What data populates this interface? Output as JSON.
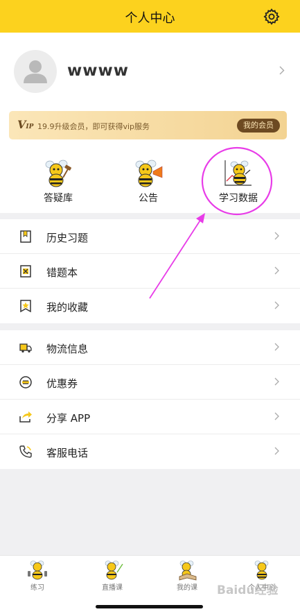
{
  "header": {
    "title": "个人中心",
    "settings_icon": "gear-icon"
  },
  "profile": {
    "username": "wwww",
    "avatar_icon": "user-placeholder-icon"
  },
  "vip_banner": {
    "logo": "V",
    "logo_sub": "IP",
    "text": "19.9升级会员，即可获得vip服务",
    "button": "我的会员"
  },
  "quick_actions": [
    {
      "label": "答疑库",
      "icon": "bee-gavel-icon"
    },
    {
      "label": "公告",
      "icon": "bee-megaphone-icon"
    },
    {
      "label": "学习数据",
      "icon": "bee-chart-icon"
    }
  ],
  "menu_group_1": [
    {
      "label": "历史习题",
      "icon": "bookmark-icon"
    },
    {
      "label": "错题本",
      "icon": "wrong-book-icon"
    },
    {
      "label": "我的收藏",
      "icon": "star-bookmark-icon"
    }
  ],
  "menu_group_2": [
    {
      "label": "物流信息",
      "icon": "truck-icon"
    },
    {
      "label": "优惠券",
      "icon": "coupon-icon"
    },
    {
      "label": "分享 APP",
      "icon": "share-icon"
    },
    {
      "label": "客服电话",
      "icon": "phone-icon"
    }
  ],
  "tabbar": [
    {
      "label": "练习",
      "icon": "bee-dumbbell-icon"
    },
    {
      "label": "直播课",
      "icon": "bee-pointer-icon"
    },
    {
      "label": "我的课",
      "icon": "bee-book-icon"
    },
    {
      "label": "个人中心",
      "icon": "bee-user-icon"
    }
  ],
  "watermark": "Baidu经验",
  "colors": {
    "brand_yellow": "#fcd21e",
    "annotation_magenta": "#e83ce8",
    "vip_brown": "#6d4a22"
  }
}
